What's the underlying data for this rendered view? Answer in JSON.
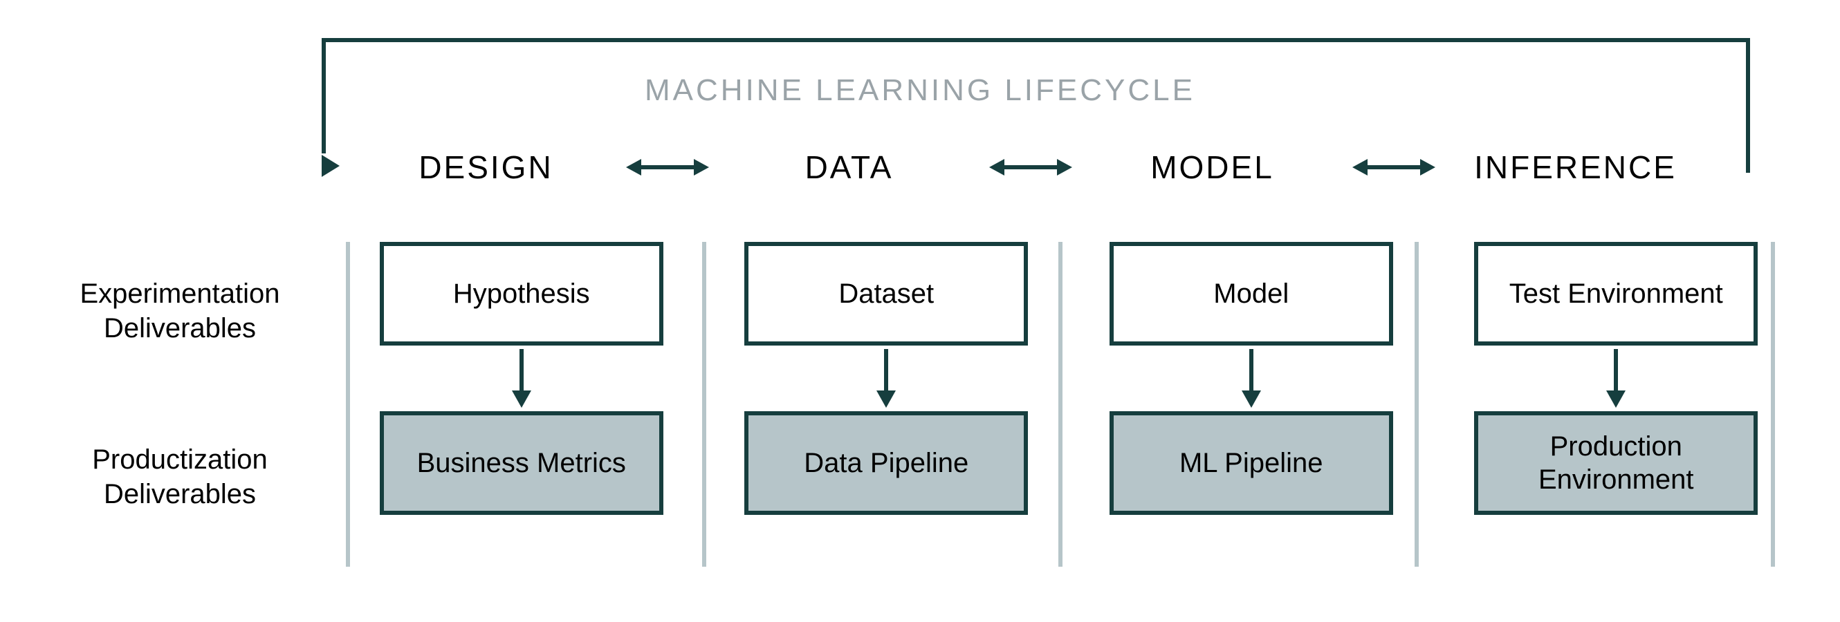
{
  "title": "MACHINE LEARNING LIFECYCLE",
  "stages": {
    "s0": "DESIGN",
    "s1": "DATA",
    "s2": "MODEL",
    "s3": "INFERENCE"
  },
  "rowLabels": {
    "experimentation": "Experimentation Deliverables",
    "productization": "Productization Deliverables"
  },
  "columns": {
    "c0": {
      "top": "Hypothesis",
      "bottom": "Business Metrics"
    },
    "c1": {
      "top": "Dataset",
      "bottom": "Data Pipeline"
    },
    "c2": {
      "top": "Model",
      "bottom": "ML Pipeline"
    },
    "c3": {
      "top": "Test Environment",
      "bottom": "Production Environment"
    }
  },
  "colors": {
    "darkTeal": "#163e3e",
    "lightGrayBlue": "#b6c5c9",
    "mutedGray": "#9aa3a8"
  }
}
